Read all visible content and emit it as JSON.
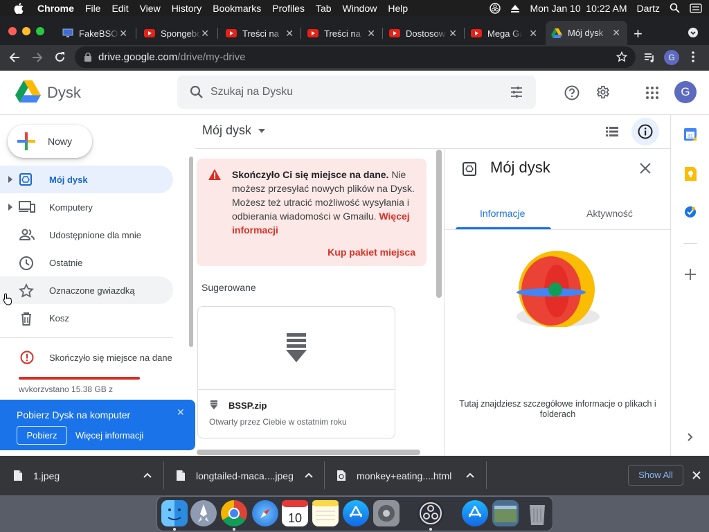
{
  "menubar": {
    "apple": "",
    "items": [
      "Chrome",
      "File",
      "Edit",
      "View",
      "History",
      "Bookmarks",
      "Profiles",
      "Tab",
      "Window",
      "Help"
    ],
    "datetime": "Mon Jan 10  10:22 AM",
    "user": "Dartz"
  },
  "tabs": [
    {
      "title": "FakeBSOD",
      "favicon": "monitor-icon"
    },
    {
      "title": "Spongebob",
      "favicon": "youtube-icon"
    },
    {
      "title": "Treści na",
      "favicon": "youtube-icon"
    },
    {
      "title": "Treści na",
      "favicon": "youtube-icon"
    },
    {
      "title": "Dostosow",
      "favicon": "youtube-icon"
    },
    {
      "title": "Mega Ga",
      "favicon": "youtube-icon"
    },
    {
      "title": "Mój dysk",
      "favicon": "google-drive-icon"
    }
  ],
  "address": {
    "host": "drive.google.com",
    "path": "/drive/my-drive",
    "profile_initial": "G"
  },
  "drive": {
    "logo_text": "Dysk",
    "search_placeholder": "Szukaj na Dysku",
    "account_initial": "G",
    "new_label": "Nowy",
    "nav": [
      {
        "label": "Mój dysk",
        "icon": "my-drive-icon",
        "selected": true
      },
      {
        "label": "Komputery",
        "icon": "computers-icon"
      },
      {
        "label": "Udostępnione dla mnie",
        "icon": "shared-icon"
      },
      {
        "label": "Ostatnie",
        "icon": "clock-icon"
      },
      {
        "label": "Oznaczone gwiazdką",
        "icon": "star-icon"
      },
      {
        "label": "Kosz",
        "icon": "trash-icon"
      }
    ],
    "storage": {
      "label": "Skończyło się miejsce na dane",
      "used_text": "wykorzystano 15,38 GB z",
      "used_fraction": 1.0
    },
    "promo": {
      "title": "Pobierz Dysk na komputer",
      "button": "Pobierz",
      "link": "Więcej informacji"
    },
    "breadcrumb": "Mój dysk",
    "alert": {
      "bold": "Skończyło Ci się miejsce na dane.",
      "text": " Nie możesz przesyłać nowych plików na Dysk. Możesz też utracić możliwość wysyłania i odbierania wiadomości w Gmailu. ",
      "link": "Więcej informacji",
      "action": "Kup pakiet miejsca"
    },
    "suggested_label": "Sugerowane",
    "files": [
      {
        "name": "BSSP.zip",
        "subtitle": "Otwarty przez Ciebie w ostatnim roku"
      }
    ],
    "details": {
      "title": "Mój dysk",
      "tabs": [
        "Informacje",
        "Aktywność"
      ],
      "active_tab": 0,
      "empty_text": "Tutaj znajdziesz szczegółowe informacje o plikach i folderach"
    }
  },
  "downloads": {
    "items": [
      {
        "name": "1.jpeg",
        "icon": "file-icon"
      },
      {
        "name": "longtailed-maca....jpeg",
        "icon": "file-icon"
      },
      {
        "name": "monkey+eating....html",
        "icon": "html-file-icon"
      }
    ],
    "show_all": "Show All"
  },
  "dock": [
    "Finder",
    "Launchpad",
    "Chrome",
    "Safari",
    "Calendar",
    "Notes",
    "App Store",
    "System Preferences",
    "OBS",
    "App Store",
    "Preview",
    "Trash"
  ],
  "colors": {
    "accent": "#1a73e8",
    "alert_bg": "#fce8e6",
    "alert_red": "#d93025",
    "storage_bar": "#d93025"
  }
}
